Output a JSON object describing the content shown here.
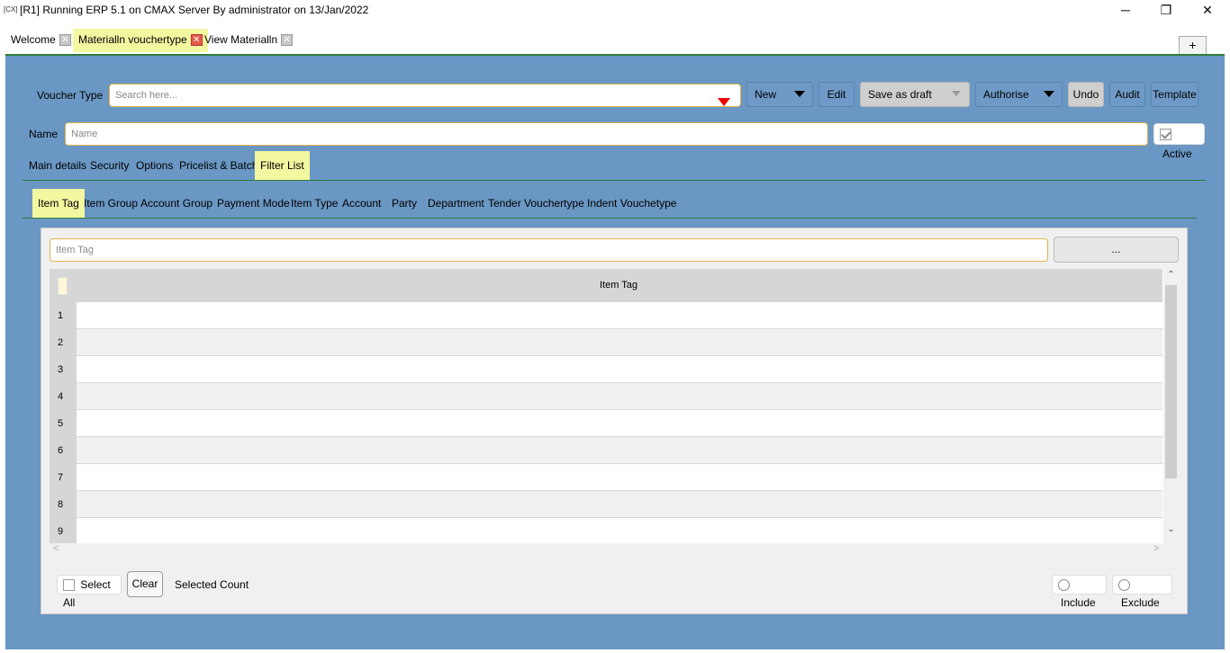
{
  "window": {
    "icon_text": "[CX]",
    "title": "[R1] Running ERP 5.1 on CMAX Server By administrator on 13/Jan/2022",
    "minimize": "─",
    "maximize": "❐",
    "close": "✕"
  },
  "doc_tabs": [
    {
      "label": "Welcome",
      "close": "✕"
    },
    {
      "label": "Materialln vouchertype",
      "close": "✕"
    },
    {
      "label": "View Materialln",
      "close": "✕"
    }
  ],
  "plus_label": "+",
  "toolbar": {
    "voucher_type_label": "Voucher Type",
    "search_placeholder": "Search here...",
    "new_label": "New",
    "edit_label": "Edit",
    "save_draft_label": "Save as draft",
    "authorise_label": "Authorise",
    "undo_label": "Undo",
    "audit_label": "Audit",
    "template_label": "Template"
  },
  "name_row": {
    "label": "Name",
    "placeholder": "Name",
    "active_label": "Active",
    "active_checked": true
  },
  "main_tabs": [
    "Main details",
    "Security",
    "Options",
    "Pricelist & Batch",
    "Filter List"
  ],
  "filter_tabs": [
    "Item Tag",
    "Item Group",
    "Account Group",
    "Payment Mode",
    "Item Type",
    "Account",
    "Party",
    "Department",
    "Tender Vouchertype",
    "Indent Vouchetype"
  ],
  "filter": {
    "input_placeholder": "Item Tag",
    "browse_label": "...",
    "column_header": "Item Tag",
    "row_numbers": [
      "1",
      "2",
      "3",
      "4",
      "5",
      "6",
      "7",
      "8",
      "9"
    ]
  },
  "footer": {
    "select_all_label": "Select All",
    "clear_label": "Clear",
    "selected_count_label": "Selected Count",
    "include_label": "Include",
    "exclude_label": "Exclude"
  },
  "scroll": {
    "up": "⌃",
    "down": "⌄",
    "left": "<",
    "right": ">"
  }
}
